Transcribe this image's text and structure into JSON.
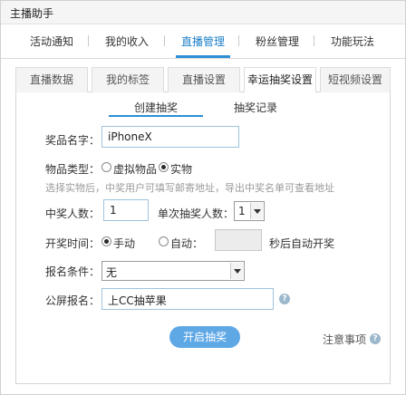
{
  "window": {
    "title": "主播助手"
  },
  "main_tabs": [
    {
      "label": "活动通知"
    },
    {
      "label": "我的收入"
    },
    {
      "label": "直播管理"
    },
    {
      "label": "粉丝管理"
    },
    {
      "label": "功能玩法"
    }
  ],
  "sub_tabs": [
    {
      "label": "直播数据"
    },
    {
      "label": "我的标签"
    },
    {
      "label": "直播设置"
    },
    {
      "label": "幸运抽奖设置"
    },
    {
      "label": "短视频设置"
    }
  ],
  "inner_tabs": [
    {
      "label": "创建抽奖"
    },
    {
      "label": "抽奖记录"
    }
  ],
  "form": {
    "prize_name_label": "奖品名字：",
    "prize_name_value": "iPhoneX",
    "item_type_label": "物品类型：",
    "virtual_label": "虚拟物品",
    "physical_label": "实物",
    "physical_hint": "选择实物后，中奖用户可填写邮寄地址，导出中奖名单可查看地址",
    "winners_label": "中奖人数：",
    "winners_value": "1",
    "per_draw_label": "单次抽奖人数：",
    "per_draw_value": "1",
    "start_time_label": "开奖时间：",
    "manual_label": "手动",
    "auto_label": "自动：",
    "auto_suffix": "秒后自动开奖",
    "condition_label": "报名条件：",
    "condition_value": "无",
    "public_label": "公屏报名：",
    "public_value": "上CC抽苹果"
  },
  "actions": {
    "start_label": "开启抽奖",
    "notes_label": "注意事项"
  }
}
